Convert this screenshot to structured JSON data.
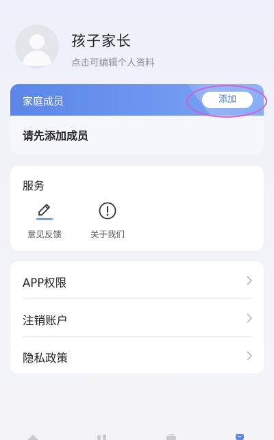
{
  "profile": {
    "name": "孩子家长",
    "edit_hint": "点击可编辑个人资料"
  },
  "family": {
    "title": "家庭成员",
    "add_label": "添加",
    "empty_text": "请先添加成员"
  },
  "service": {
    "title": "服务",
    "items": [
      {
        "label": "意见反馈",
        "icon": "pencil-icon"
      },
      {
        "label": "关于我们",
        "icon": "info-circle-icon"
      }
    ]
  },
  "menu": {
    "items": [
      {
        "label": "APP权限"
      },
      {
        "label": "注销账户"
      },
      {
        "label": "隐私政策"
      }
    ]
  },
  "colors": {
    "accent": "#5b85e8",
    "highlight": "#d35fcf",
    "tab_active": "#5b85e8"
  }
}
